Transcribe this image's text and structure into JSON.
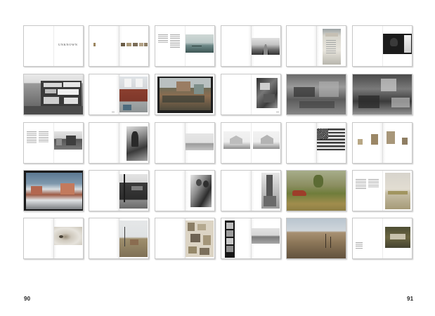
{
  "page": {
    "left_page_number": "90",
    "right_page_number": "91"
  },
  "spreads": [
    {
      "label": "title-spread",
      "title_text": "UNKNOWN"
    },
    {
      "label": "small-photo-strip-spread"
    },
    {
      "label": "text-and-sea-photo-spread"
    },
    {
      "label": "railroad-tracks-spread"
    },
    {
      "label": "weathered-poster-spread"
    },
    {
      "label": "window-silhouette-spread"
    },
    {
      "label": "painted-sign-building-spread"
    },
    {
      "label": "red-brick-house-spread"
    },
    {
      "label": "color-town-view-spread"
    },
    {
      "label": "cluttered-interior-spread"
    },
    {
      "label": "junkyard-spread"
    },
    {
      "label": "debris-room-spread"
    },
    {
      "label": "text-and-street-spread"
    },
    {
      "label": "statue-spread"
    },
    {
      "label": "empty-landscape-spread"
    },
    {
      "label": "two-houses-spread"
    },
    {
      "label": "american-flag-spread"
    },
    {
      "label": "sepia-portraits-spread"
    },
    {
      "label": "snowy-city-spread"
    },
    {
      "label": "storefront-spread"
    },
    {
      "label": "portrait-pair-spread"
    },
    {
      "label": "grain-elevator-spread"
    },
    {
      "label": "car-in-field-spread"
    },
    {
      "label": "text-and-tennis-court-spread"
    },
    {
      "label": "sink-drain-spread"
    },
    {
      "label": "dirt-road-spread"
    },
    {
      "label": "collage-spread"
    },
    {
      "label": "film-strip-spread"
    },
    {
      "label": "prairie-fence-spread"
    },
    {
      "label": "colophon-spread"
    }
  ]
}
